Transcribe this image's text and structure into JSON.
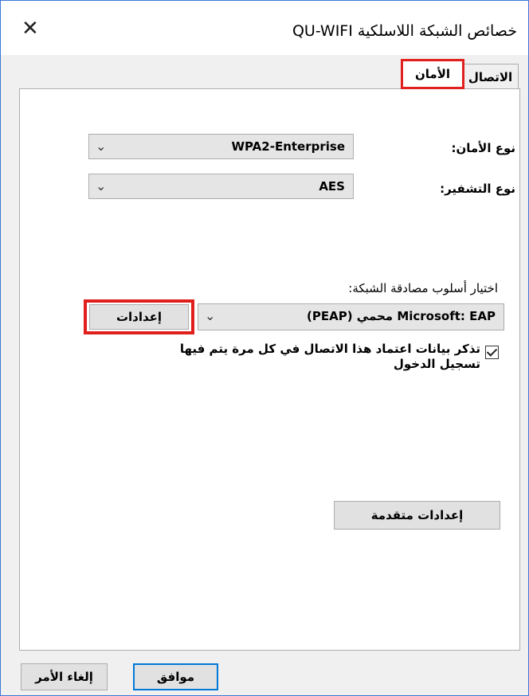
{
  "window": {
    "title": "خصائص الشبكة اللاسلكية QU-WIFI",
    "close_glyph": "✕"
  },
  "tabs": [
    {
      "label": "الاتصال"
    },
    {
      "label": "الأمان"
    }
  ],
  "security": {
    "security_type_label": "نوع الأمان:",
    "security_type_value": "WPA2-Enterprise",
    "encryption_type_label": "نوع التشفير:",
    "encryption_type_value": "AES",
    "auth_method_label": "اختيار أسلوب مصادقة الشبكة:",
    "auth_method_value": "Microsoft: EAP محمي (PEAP)",
    "settings_button": "إعدادات",
    "remember_label": "تذكر بيانات اعتماد هذا الاتصال في كل مرة يتم فيها تسجيل الدخول",
    "remember_checked": true,
    "advanced_button": "إعدادات متقدمة"
  },
  "footer": {
    "ok_button": "موافق",
    "cancel_button": "إلغاء الأمر"
  },
  "colors": {
    "highlight": "#e0201c",
    "accent": "#0078d7",
    "border": "#3c78d8"
  },
  "icons": {
    "dropdown": "chevron-down-icon",
    "close": "close-icon",
    "checkbox": "check-icon"
  }
}
